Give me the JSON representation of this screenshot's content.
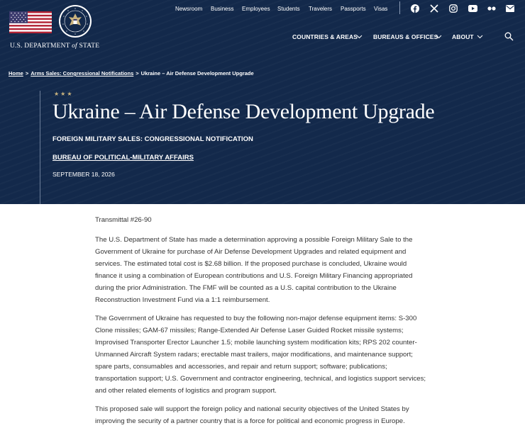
{
  "brand": {
    "department_prefix": "U.S. DEPARTMENT ",
    "department_of": "of",
    "department_suffix": " STATE"
  },
  "top_nav": [
    "Newsroom",
    "Business",
    "Employees",
    "Students",
    "Travelers",
    "Passports",
    "Visas"
  ],
  "social_icons": [
    "facebook-icon",
    "x-icon",
    "instagram-icon",
    "youtube-icon",
    "flickr-icon",
    "email-icon"
  ],
  "main_nav": [
    "COUNTRIES & AREAS",
    "BUREAUS & OFFICES",
    "ABOUT"
  ],
  "breadcrumb": {
    "home": "Home",
    "parent": "Arms Sales: Congressional Notifications",
    "current": "Ukraine – Air Defense Development Upgrade",
    "separator": ">"
  },
  "hero": {
    "stars": "★★★",
    "title": "Ukraine – Air Defense Development Upgrade",
    "kicker": "FOREIGN MILITARY SALES: CONGRESSIONAL NOTIFICATION",
    "bureau": "BUREAU OF POLITICAL-MILITARY AFFAIRS",
    "date": "SEPTEMBER 18, 2026"
  },
  "article": {
    "transmittal": "Transmittal #26-90",
    "paragraphs": [
      "The U.S. Department of State has made a determination approving a possible Foreign Military Sale to the Government of Ukraine for purchase of Air Defense Development Upgrades and related equipment and services. The estimated total cost is $2.68 billion. If the proposed purchase is concluded, Ukraine would finance it using a combination of European contributions and U.S. Foreign Military Financing appropriated during the prior Administration. The FMF will be counted as a U.S. capital contribution to the Ukraine Reconstruction Investment Fund via a 1:1 reimbursement.",
      "The Government of Ukraine has requested to buy the following non-major defense equipment items: S-300 Clone missiles; GAM-67 missiles; Range-Extended Air Defense Laser Guided Rocket missile systems; Improvised Transporter Erector Launcher 1.5; mobile launching system modification kits; RPS 202 counter-Unmanned Aircraft System radars; erectable mast trailers, major modifications, and maintenance support; spare parts, consumables and accessories, and repair and return support; software; publications; transportation support; U.S. Government and contractor engineering, technical, and logistics support services; and other related elements of logistics and program support.",
      "This proposed sale will support the foreign policy and national security objectives of the United States by improving the security of a partner country that is a force for political and economic progress in Europe."
    ]
  },
  "colors": {
    "header_bg": "#13294b",
    "star_gold": "#c9b37e",
    "body_text": "#333333"
  }
}
